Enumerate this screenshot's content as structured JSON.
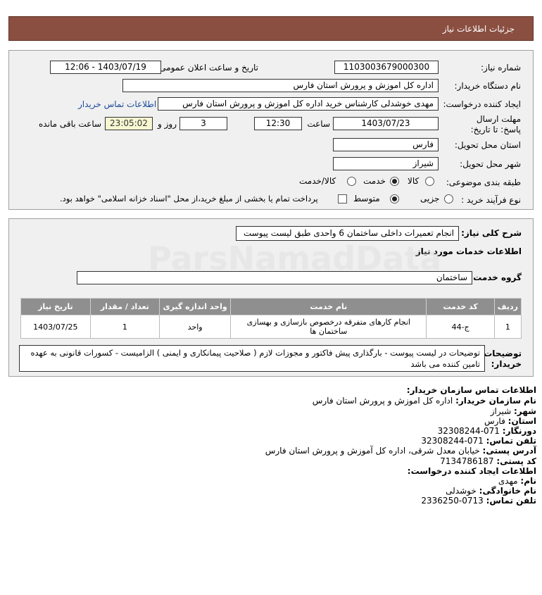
{
  "header": {
    "title": "جزئیات اطلاعات نیاز"
  },
  "form": {
    "need_number_label": "شماره نیاز:",
    "need_number": "1103003679000300",
    "announce_label": "تاریخ و ساعت اعلان عمومی:",
    "announce_value": "1403/07/19 - 12:06",
    "buyer_org_label": "نام دستگاه خریدار:",
    "buyer_org": "اداره کل اموزش و پرورش استان فارس",
    "creator_label": "ایجاد کننده درخواست:",
    "creator": "مهدی خوشدلی کارشناس خرید اداره کل اموزش و پرورش استان فارس",
    "contact_link": "اطلاعات تماس خریدار",
    "deadline_label": "مهلت ارسال پاسخ: تا تاریخ:",
    "deadline_date": "1403/07/23",
    "time_label": "ساعت",
    "deadline_time": "12:30",
    "days": "3",
    "days_label": "روز و",
    "remaining": "23:05:02",
    "remaining_label": "ساعت باقی مانده",
    "province_label": "استان محل تحویل:",
    "province": "فارس",
    "city_label": "شهر محل تحویل:",
    "city": "شیراز",
    "category_label": "طبقه بندی موضوعی:",
    "category_options": [
      "کالا",
      "خدمت",
      "کالا/خدمت"
    ],
    "category_selected": "خدمت",
    "process_label": "نوع فرآیند خرید :",
    "process_options": [
      "جزیی",
      "متوسط"
    ],
    "process_selected": "متوسط",
    "payment_note": "پرداخت تمام یا بخشی از مبلغ خرید،از محل \"اسناد خزانه اسلامی\" خواهد بود."
  },
  "details": {
    "summary_label": "شرح کلی نیاز:",
    "summary": "انجام تعمیرات داخلی ساختمان 6 واحدی طبق لیست پیوست",
    "services_heading": "اطلاعات خدمات مورد نیاز",
    "group_label": "گروه خدمت:",
    "group_value": "ساختمان",
    "table_headers": [
      "ردیف",
      "کد خدمت",
      "نام خدمت",
      "واحد اندازه گیری",
      "تعداد / مقدار",
      "تاریخ نیاز"
    ],
    "rows": [
      {
        "index": "1",
        "code": "ج-44",
        "name": "انجام کارهای متفرقه درخصوص بازسازی و بهسازی ساختمان ها",
        "unit": "واحد",
        "qty": "1",
        "date": "1403/07/25"
      }
    ],
    "notes_label": "توضیحات خریدار:",
    "notes": "توضیحات در لیست پیوست - بارگذاری پیش فاکتور و مجوزات لازم ( صلاحیت پیمانکاری و ایمنی ) الزامیست - کسورات قانونی به عهده تامین کننده می باشد"
  },
  "contact": {
    "title": "اطلاعات تماس سازمان خریدار:",
    "org_label": "نام سازمان خریدار:",
    "org": "اداره کل اموزش و پرورش استان فارس",
    "city_label": "شهر:",
    "city": "شیراز",
    "province_label": "استان:",
    "province": "فارس",
    "fax_label": "دورنگار:",
    "fax": "071-32308244",
    "phone_label": "تلفن تماس:",
    "phone": "071-32308244",
    "address_label": "آدرس پستی:",
    "address": "خیابان معدل شرقی، اداره کل آموزش و پرورش استان فارس",
    "postal_label": "کد پستی:",
    "postal": "7134786187",
    "creator_title": "اطلاعات ایجاد کننده درخواست:",
    "first_name_label": "نام:",
    "first_name": "مهدی",
    "last_name_label": "نام خانوادگی:",
    "last_name": "خوشدلی",
    "creator_phone_label": "تلفن تماس:",
    "creator_phone": "0713-2336250"
  },
  "colors": {
    "header_bg": "#8a4f41",
    "table_header_bg": "#8f8f8f",
    "link": "#1a4a9a"
  }
}
